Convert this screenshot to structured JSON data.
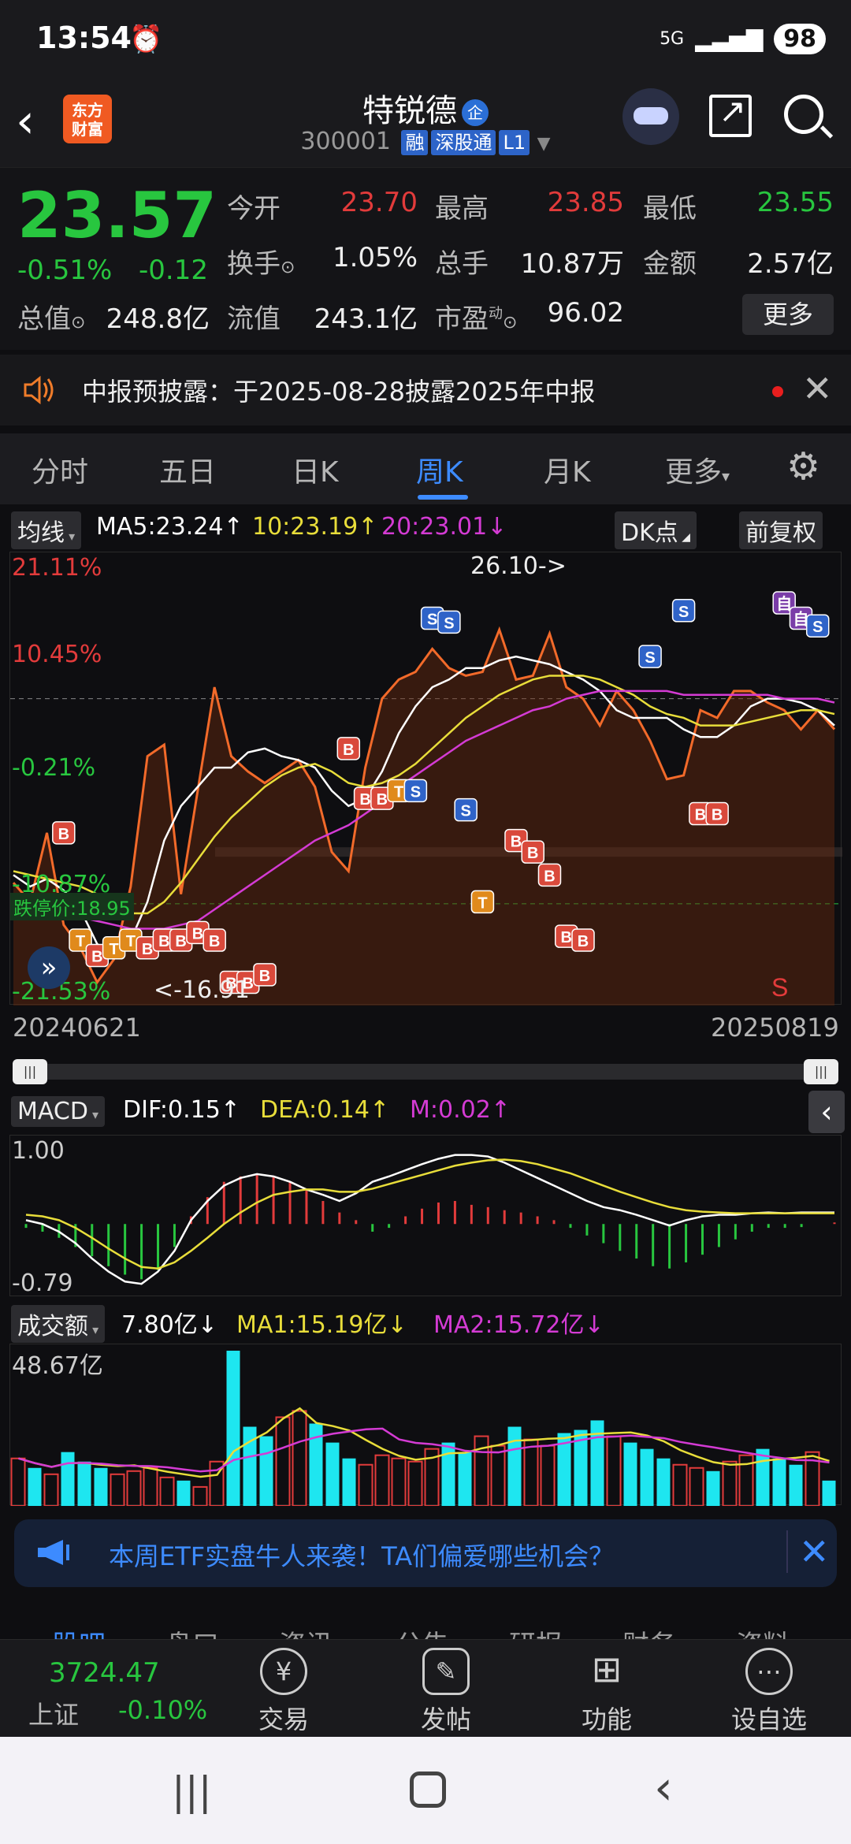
{
  "status": {
    "time": "13:54",
    "network": "5G",
    "battery": "98"
  },
  "header": {
    "logo_line1": "东方",
    "logo_line2": "财富",
    "name": "特锐德",
    "name_badge": "企",
    "code": "300001",
    "tag_rong": "融",
    "tag_sgt": "深股通",
    "tag_l1": "L1"
  },
  "quote": {
    "price": "23.57",
    "pct": "-0.51%",
    "change": "-0.12",
    "open_label": "今开",
    "open": "23.70",
    "high_label": "最高",
    "high": "23.85",
    "low_label": "最低",
    "low": "23.55",
    "turnover_label": "换手",
    "turnover": "1.05%",
    "vol_label": "总手",
    "vol": "10.87万",
    "amount_label": "金额",
    "amount": "2.57亿",
    "mktcap_label": "总值",
    "mktcap": "248.8亿",
    "float_label": "流值",
    "float": "243.1亿",
    "pe_label": "市盈",
    "pe_sup": "动",
    "pe": "96.02",
    "more": "更多"
  },
  "notice": {
    "text": "中报预披露：于2025-08-28披露2025年中报"
  },
  "tabs": [
    "分时",
    "五日",
    "日K",
    "周K",
    "月K",
    "更多"
  ],
  "ma_bar": {
    "select": "均线",
    "ma5": "MA5:23.24",
    "ma10": "10:23.19",
    "ma20": "20:23.01",
    "dk": "DK点",
    "adj": "前复权"
  },
  "chart_data": [
    {
      "type": "line",
      "title": "",
      "y_labels": [
        "21.11%",
        "10.45%",
        "-0.21%",
        "-10.87%",
        "-21.53%"
      ],
      "annotations": [
        "26.10->",
        "<-16.91",
        "跌停价:18.95"
      ],
      "x_range": [
        "20240621",
        "20250819"
      ],
      "series": [
        {
          "name": "",
          "values": [
            19.5,
            19.0,
            20.8,
            18.4,
            17.8,
            16.9,
            17.5,
            19.4,
            22.8,
            23.1,
            19.2,
            21.9,
            24.6,
            22.8,
            22.4,
            22.1,
            22.4,
            22.7,
            22.0,
            20.3,
            19.8,
            22.5,
            24.3,
            24.8,
            25.0,
            25.6,
            25.1,
            24.9,
            25.0,
            26.1,
            24.8,
            24.9,
            26.0,
            24.6,
            24.3,
            23.6,
            24.5,
            24.0,
            23.2,
            22.2,
            22.3,
            24.0,
            23.8,
            24.5,
            24.5,
            24.2,
            24.0,
            23.5,
            24.0,
            23.5
          ]
        },
        {
          "name": "",
          "values": [
            19.7,
            19.4,
            19.6,
            19.3,
            18.8,
            17.9,
            17.6,
            18.0,
            19.0,
            20.6,
            21.5,
            22.0,
            22.5,
            22.5,
            22.9,
            23.0,
            22.8,
            22.7,
            22.5,
            21.9,
            21.5,
            21.7,
            22.4,
            23.4,
            24.1,
            24.6,
            24.8,
            25.1,
            25.1,
            25.3,
            25.4,
            25.3,
            25.2,
            25.0,
            24.8,
            24.5,
            24.0,
            23.8,
            23.8,
            23.8,
            23.5,
            23.3,
            23.3,
            23.6,
            24.1,
            24.3,
            24.3,
            24.2,
            24.0,
            23.6
          ]
        },
        {
          "name": "",
          "values": [
            19.8,
            19.7,
            19.6,
            19.5,
            19.4,
            19.2,
            18.9,
            18.7,
            18.7,
            19.0,
            19.5,
            20.1,
            20.7,
            21.2,
            21.6,
            22.0,
            22.3,
            22.5,
            22.6,
            22.4,
            22.1,
            22.0,
            22.1,
            22.3,
            22.6,
            23.0,
            23.4,
            23.8,
            24.1,
            24.4,
            24.6,
            24.8,
            24.9,
            24.9,
            24.9,
            24.8,
            24.6,
            24.4,
            24.1,
            23.9,
            23.8,
            23.6,
            23.6,
            23.6,
            23.7,
            23.8,
            23.9,
            24.0,
            24.0,
            23.9
          ]
        },
        {
          "name": "",
          "values": [
            18.9,
            18.8,
            18.7,
            18.7,
            18.6,
            18.5,
            18.4,
            18.3,
            18.3,
            18.3,
            18.4,
            18.5,
            18.8,
            19.1,
            19.4,
            19.7,
            20.0,
            20.3,
            20.6,
            20.8,
            21.0,
            21.3,
            21.6,
            22.0,
            22.3,
            22.6,
            22.9,
            23.2,
            23.4,
            23.6,
            23.8,
            24.0,
            24.1,
            24.3,
            24.4,
            24.5,
            24.5,
            24.5,
            24.5,
            24.5,
            24.4,
            24.4,
            24.4,
            24.4,
            24.4,
            24.4,
            24.3,
            24.3,
            24.3,
            24.2
          ]
        }
      ],
      "ylim": [
        16.5,
        27.5
      ]
    },
    {
      "type": "bar",
      "title": "",
      "y_labels": [
        "1.00",
        "-0.79"
      ],
      "values": [
        -0.05,
        -0.1,
        -0.18,
        -0.3,
        -0.42,
        -0.55,
        -0.66,
        -0.72,
        -0.6,
        -0.3,
        0.1,
        0.35,
        0.55,
        0.62,
        0.66,
        0.62,
        0.55,
        0.45,
        0.3,
        0.15,
        0.05,
        -0.1,
        -0.05,
        0.1,
        0.2,
        0.28,
        0.3,
        0.25,
        0.22,
        0.18,
        0.15,
        0.1,
        0.05,
        -0.05,
        -0.15,
        -0.25,
        -0.35,
        -0.45,
        -0.55,
        -0.58,
        -0.5,
        -0.4,
        -0.3,
        -0.2,
        -0.1,
        -0.05,
        -0.05,
        -0.04,
        0.0,
        0.02
      ],
      "series": [
        {
          "name": "DIF",
          "values": [
            0.05,
            0.0,
            -0.1,
            -0.25,
            -0.45,
            -0.62,
            -0.75,
            -0.78,
            -0.62,
            -0.35,
            0.05,
            0.3,
            0.5,
            0.6,
            0.65,
            0.62,
            0.55,
            0.45,
            0.38,
            0.3,
            0.4,
            0.55,
            0.62,
            0.7,
            0.78,
            0.85,
            0.9,
            0.9,
            0.88,
            0.8,
            0.7,
            0.6,
            0.5,
            0.4,
            0.3,
            0.22,
            0.18,
            0.12,
            0.05,
            -0.02,
            0.05,
            0.1,
            0.12,
            0.12,
            0.14,
            0.15,
            0.14,
            0.15,
            0.15,
            0.15
          ]
        },
        {
          "name": "DEA",
          "values": [
            0.12,
            0.1,
            0.05,
            -0.05,
            -0.18,
            -0.32,
            -0.45,
            -0.56,
            -0.58,
            -0.5,
            -0.35,
            -0.18,
            0.0,
            0.15,
            0.28,
            0.38,
            0.42,
            0.45,
            0.45,
            0.42,
            0.42,
            0.46,
            0.52,
            0.58,
            0.64,
            0.7,
            0.76,
            0.8,
            0.83,
            0.84,
            0.82,
            0.78,
            0.72,
            0.66,
            0.58,
            0.5,
            0.42,
            0.35,
            0.28,
            0.22,
            0.18,
            0.16,
            0.15,
            0.14,
            0.14,
            0.14,
            0.14,
            0.14,
            0.14,
            0.14
          ]
        }
      ],
      "ylim": [
        -0.85,
        1.05
      ]
    },
    {
      "type": "bar",
      "title": "",
      "y_labels": [
        "48.67亿"
      ],
      "values": [
        15,
        12,
        10,
        17,
        14,
        12,
        10,
        11,
        12,
        9,
        8,
        6,
        14,
        49,
        25,
        22,
        28,
        30,
        26,
        20,
        15,
        13,
        16,
        15,
        14,
        18,
        20,
        17,
        22,
        19,
        25,
        21,
        19,
        23,
        24,
        27,
        22,
        20,
        18,
        15,
        13,
        12,
        11,
        14,
        16,
        18,
        15,
        13,
        17,
        8
      ],
      "ylim": [
        0,
        50
      ]
    }
  ],
  "markers": {
    "b": "B",
    "s": "S",
    "t": "T",
    "zi": "自"
  },
  "macd_bar": {
    "select": "MACD",
    "dif": "DIF:0.15",
    "dea": "DEA:0.14",
    "m": "M:0.02"
  },
  "vol_bar": {
    "select": "成交额",
    "vol": "7.80亿",
    "ma1": "MA1:15.19亿",
    "ma2": "MA2:15.72亿"
  },
  "banner": {
    "text": "本周ETF实盘牛人来袭！TA们偏爱哪些机会？"
  },
  "subtabs": [
    "股吧",
    "盘口",
    "资讯",
    "公告",
    "研报",
    "财务",
    "资料"
  ],
  "bottom_nav": {
    "index_value": "3724.47",
    "index_name": "上证",
    "index_change": "-0.10%",
    "items": [
      "交易",
      "发帖",
      "功能",
      "设自选"
    ]
  },
  "colors": {
    "up": "#e23b3b",
    "down": "#28c63f",
    "accent": "#3d8bff",
    "ma10": "#e8dd3a",
    "ma20": "#d43bd4"
  }
}
